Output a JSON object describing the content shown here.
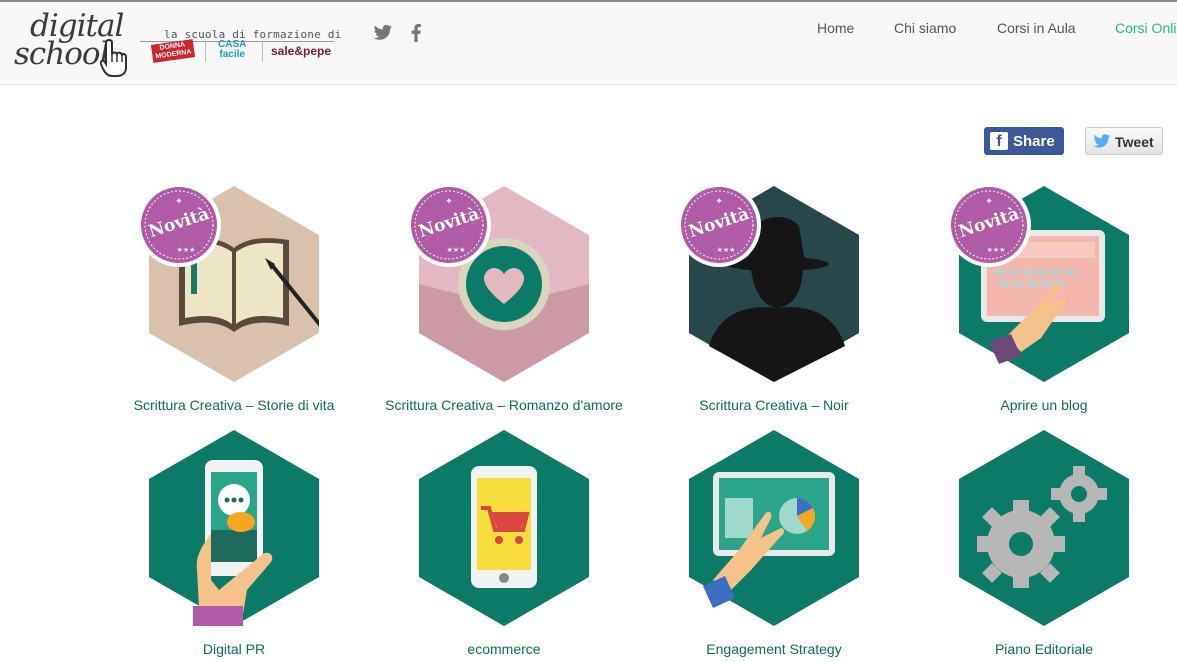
{
  "logo": {
    "line1": "digital",
    "line2": "school"
  },
  "tagline": "la scuola di formazione di",
  "brands": {
    "donna_moderna": "DONNA MODERNA",
    "casa_facile_1": "CASA",
    "casa_facile_2": "facile",
    "sale_pepe": "sale&pepe"
  },
  "social": {
    "twitter": "twitter-icon",
    "facebook": "facebook-icon"
  },
  "nav": [
    {
      "label": "Home"
    },
    {
      "label": "Chi siamo"
    },
    {
      "label": "Corsi in Aula"
    },
    {
      "label": "Corsi Online",
      "active": true
    }
  ],
  "share": {
    "facebook_label": "Share",
    "tweet_label": "Tweet"
  },
  "badge_label": "Novità",
  "colors": {
    "teal": "#0b7a66",
    "nav_active": "#2bb58f",
    "title": "#0c6e5c",
    "badge": "#b15aa5",
    "facebook": "#3b5998"
  },
  "courses": [
    {
      "title": "Scrittura Creativa – Storie di vita",
      "novita": true,
      "icon": "book-pen-icon"
    },
    {
      "title": "Scrittura Creativa – Romanzo d'amore",
      "novita": true,
      "icon": "heart-envelope-icon"
    },
    {
      "title": "Scrittura Creativa – Noir",
      "novita": true,
      "icon": "noir-silhouette-icon"
    },
    {
      "title": "Aprire un blog",
      "novita": true,
      "icon": "blog-tablet-keyboard-icon"
    },
    {
      "title": "Digital PR",
      "novita": false,
      "icon": "smartphone-chat-icon"
    },
    {
      "title": "ecommerce",
      "novita": false,
      "icon": "phone-cart-icon"
    },
    {
      "title": "Engagement Strategy",
      "novita": false,
      "icon": "tablet-chart-icon"
    },
    {
      "title": "Piano Editoriale",
      "novita": false,
      "icon": "gears-icon"
    }
  ]
}
